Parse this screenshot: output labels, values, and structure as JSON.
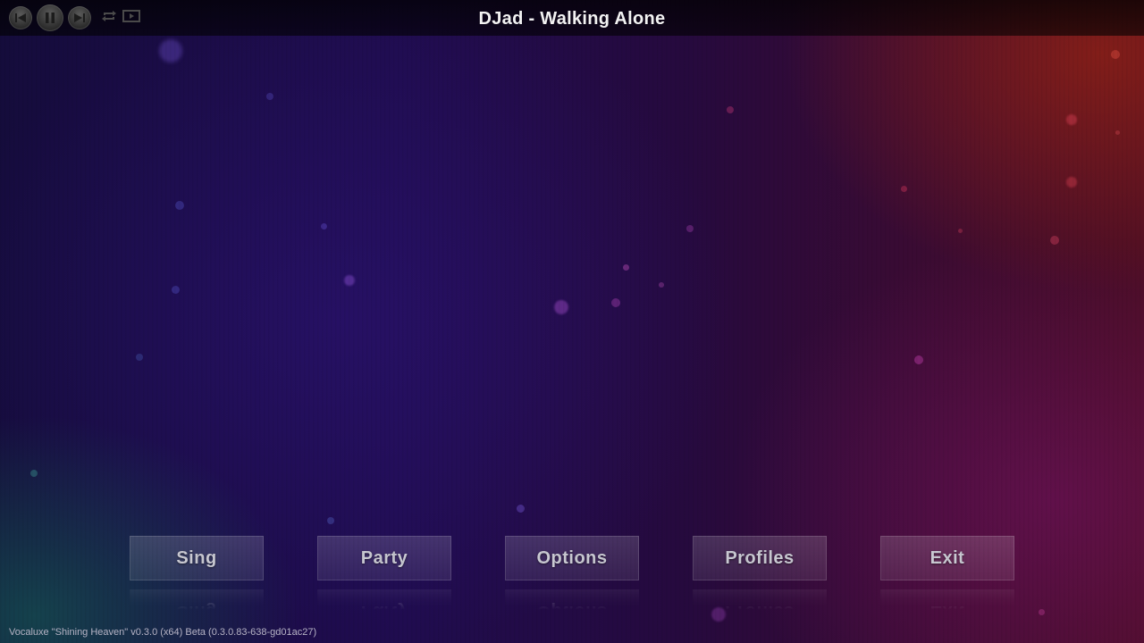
{
  "player": {
    "song_title": "DJad - Walking Alone",
    "controls": [
      {
        "name": "previous-icon"
      },
      {
        "name": "pause-icon"
      },
      {
        "name": "next-icon"
      },
      {
        "name": "repeat-icon"
      },
      {
        "name": "video-icon"
      }
    ]
  },
  "menu": {
    "buttons": [
      {
        "label": "Sing"
      },
      {
        "label": "Party"
      },
      {
        "label": "Options"
      },
      {
        "label": "Profiles"
      },
      {
        "label": "Exit"
      }
    ]
  },
  "footer": {
    "version_text": "Vocaluxe \"Shining Heaven\" v0.3.0 (x64) Beta (0.3.0.83-638-gd01ac27)"
  },
  "colors": {
    "text_primary": "#f2f2f2",
    "button_text": "#c9c9d2",
    "version_text": "#b9b6c8"
  }
}
